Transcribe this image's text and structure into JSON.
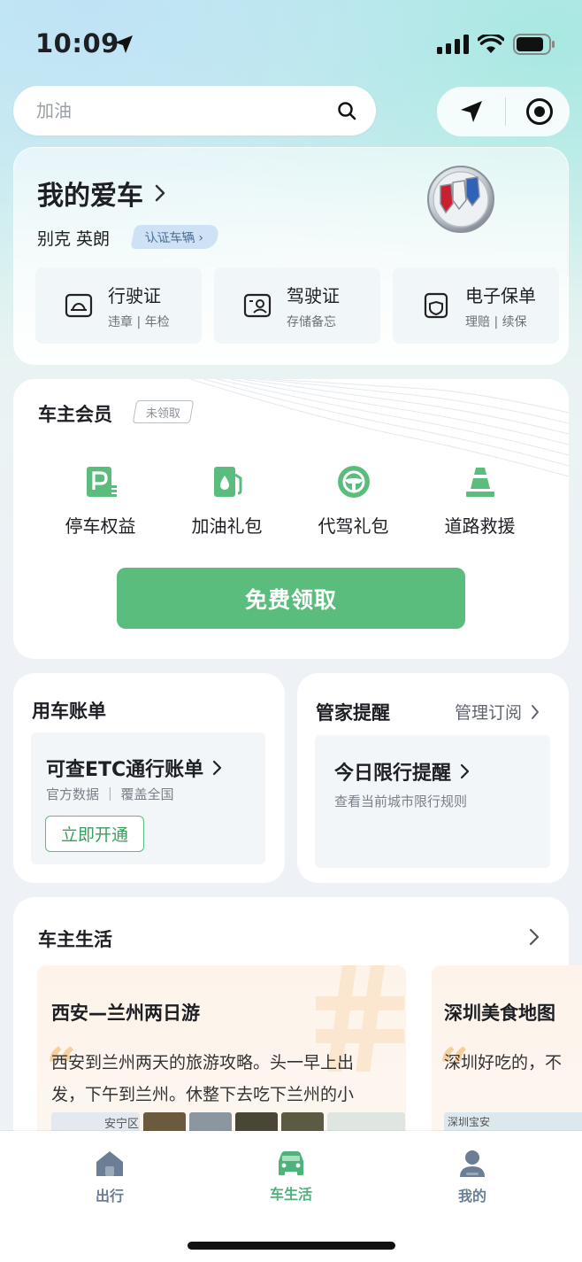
{
  "status_bar": {
    "time": "10:09"
  },
  "search": {
    "placeholder": "加油"
  },
  "my_car": {
    "title": "我的爱车",
    "car_name": "别克 英朗",
    "cert_label": "认证车辆",
    "tiles": [
      {
        "label": "行驶证",
        "sub": "违章 | 年检",
        "icon": "vehicle-license-icon"
      },
      {
        "label": "驾驶证",
        "sub": "存储备忘",
        "icon": "driver-license-icon"
      },
      {
        "label": "电子保单",
        "sub": "理赔 | 续保",
        "icon": "insurance-policy-icon"
      }
    ]
  },
  "membership": {
    "title": "车主会员",
    "badge": "未领取",
    "perks": [
      {
        "label": "停车权益",
        "icon": "parking-icon"
      },
      {
        "label": "加油礼包",
        "icon": "fuel-icon"
      },
      {
        "label": "代驾礼包",
        "icon": "steering-wheel-icon"
      },
      {
        "label": "道路救援",
        "icon": "traffic-cone-icon"
      }
    ],
    "claim_button": "免费领取",
    "colors": {
      "accent": "#5bbd7d"
    }
  },
  "bill": {
    "title": "用车账单",
    "etc_title": "可查ETC通行账单",
    "etc_sub": "官方数据 ｜ 覆盖全国",
    "open_button": "立即开通"
  },
  "reminder": {
    "title": "管家提醒",
    "manage": "管理订阅",
    "limit_title": "今日限行提醒",
    "limit_sub": "查看当前城市限行规则"
  },
  "life": {
    "title": "车主生活",
    "cards": [
      {
        "title": "西安—兰州两日游",
        "line1": "西安到兰州两天的旅游攻略。头一早上出",
        "line2": "发，下午到兰州。休整下去吃下兰州的小",
        "map_label": "安宁区"
      },
      {
        "title": "深圳美食地图",
        "line1": "深圳好吃的，不",
        "map_label": "深圳宝安"
      }
    ]
  },
  "tabbar": {
    "tabs": [
      {
        "label": "出行",
        "icon": "travel-icon"
      },
      {
        "label": "车生活",
        "icon": "car-icon"
      },
      {
        "label": "我的",
        "icon": "profile-icon"
      }
    ],
    "active": "车生活"
  }
}
